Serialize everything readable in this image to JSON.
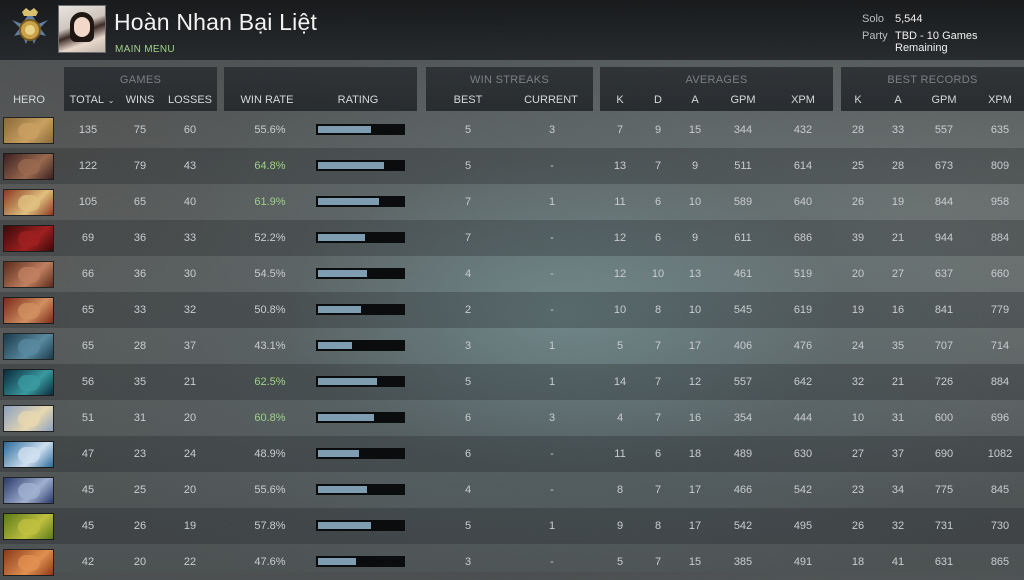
{
  "profile": {
    "name": "Hoàn Nhan Bại Liệt",
    "main_menu": "MAIN MENU",
    "solo_label": "Solo",
    "solo_value": "5,544",
    "party_label": "Party",
    "party_value": "TBD - 10 Games Remaining"
  },
  "groups": {
    "games": "GAMES",
    "win_streaks": "WIN STREAKS",
    "averages": "AVERAGES",
    "best_records": "BEST RECORDS"
  },
  "columns": {
    "hero": "HERO",
    "total": "TOTAL",
    "wins": "WINS",
    "losses": "LOSSES",
    "win_rate": "WIN RATE",
    "rating": "RATING",
    "best": "BEST",
    "current": "CURRENT",
    "k": "K",
    "d": "D",
    "a": "A",
    "gpm": "GPM",
    "xpm": "XPM",
    "best_k": "K",
    "best_a": "A",
    "best_gpm": "GPM",
    "best_xpm": "XPM"
  },
  "rows": [
    {
      "total": "135",
      "wins": "75",
      "losses": "60",
      "win_rate": "55.6%",
      "rating": 0.62,
      "best": "5",
      "current": "3",
      "k": "7",
      "d": "9",
      "a": "15",
      "gpm": "344",
      "xpm": "432",
      "bk": "28",
      "ba": "33",
      "bgpm": "557",
      "bxpm": "635",
      "colors": [
        "#8a6a3a",
        "#c9a060"
      ]
    },
    {
      "total": "122",
      "wins": "79",
      "losses": "43",
      "win_rate": "64.8%",
      "rating": 0.78,
      "best": "5",
      "current": "-",
      "k": "13",
      "d": "7",
      "a": "9",
      "gpm": "511",
      "xpm": "614",
      "bk": "25",
      "ba": "28",
      "bgpm": "673",
      "bxpm": "809",
      "colors": [
        "#3a2020",
        "#9a6a50"
      ]
    },
    {
      "total": "105",
      "wins": "65",
      "losses": "40",
      "win_rate": "61.9%",
      "rating": 0.72,
      "best": "7",
      "current": "1",
      "k": "11",
      "d": "6",
      "a": "10",
      "gpm": "589",
      "xpm": "640",
      "bk": "26",
      "ba": "19",
      "bgpm": "844",
      "bxpm": "958",
      "colors": [
        "#8a3a20",
        "#e0c080"
      ]
    },
    {
      "total": "69",
      "wins": "36",
      "losses": "33",
      "win_rate": "52.2%",
      "rating": 0.55,
      "best": "7",
      "current": "-",
      "k": "12",
      "d": "6",
      "a": "9",
      "gpm": "611",
      "xpm": "686",
      "bk": "39",
      "ba": "21",
      "bgpm": "944",
      "bxpm": "884",
      "colors": [
        "#3a0a0a",
        "#a02020"
      ]
    },
    {
      "total": "66",
      "wins": "36",
      "losses": "30",
      "win_rate": "54.5%",
      "rating": 0.58,
      "best": "4",
      "current": "-",
      "k": "12",
      "d": "10",
      "a": "13",
      "gpm": "461",
      "xpm": "519",
      "bk": "20",
      "ba": "27",
      "bgpm": "637",
      "bxpm": "660",
      "colors": [
        "#5a2a1a",
        "#c08060"
      ]
    },
    {
      "total": "65",
      "wins": "33",
      "losses": "32",
      "win_rate": "50.8%",
      "rating": 0.5,
      "best": "2",
      "current": "-",
      "k": "10",
      "d": "8",
      "a": "10",
      "gpm": "545",
      "xpm": "619",
      "bk": "19",
      "ba": "16",
      "bgpm": "841",
      "bxpm": "779",
      "colors": [
        "#7a2a1a",
        "#d09060"
      ]
    },
    {
      "total": "65",
      "wins": "28",
      "losses": "37",
      "win_rate": "43.1%",
      "rating": 0.4,
      "best": "3",
      "current": "1",
      "k": "5",
      "d": "7",
      "a": "17",
      "gpm": "406",
      "xpm": "476",
      "bk": "24",
      "ba": "35",
      "bgpm": "707",
      "bxpm": "714",
      "colors": [
        "#1a3a4a",
        "#5a8aa0"
      ]
    },
    {
      "total": "56",
      "wins": "35",
      "losses": "21",
      "win_rate": "62.5%",
      "rating": 0.7,
      "best": "5",
      "current": "1",
      "k": "14",
      "d": "7",
      "a": "12",
      "gpm": "557",
      "xpm": "642",
      "bk": "32",
      "ba": "21",
      "bgpm": "726",
      "bxpm": "884",
      "colors": [
        "#0a2a3a",
        "#3a9aa0"
      ]
    },
    {
      "total": "51",
      "wins": "31",
      "losses": "20",
      "win_rate": "60.8%",
      "rating": 0.66,
      "best": "6",
      "current": "3",
      "k": "4",
      "d": "7",
      "a": "16",
      "gpm": "354",
      "xpm": "444",
      "bk": "10",
      "ba": "31",
      "bgpm": "600",
      "bxpm": "696",
      "colors": [
        "#8aa0c0",
        "#e8d8b0"
      ]
    },
    {
      "total": "47",
      "wins": "23",
      "losses": "24",
      "win_rate": "48.9%",
      "rating": 0.48,
      "best": "6",
      "current": "-",
      "k": "11",
      "d": "6",
      "a": "18",
      "gpm": "489",
      "xpm": "630",
      "bk": "27",
      "ba": "37",
      "bgpm": "690",
      "bxpm": "1082",
      "colors": [
        "#2a6a9a",
        "#d0e0f0"
      ]
    },
    {
      "total": "45",
      "wins": "25",
      "losses": "20",
      "win_rate": "55.6%",
      "rating": 0.58,
      "best": "4",
      "current": "-",
      "k": "8",
      "d": "7",
      "a": "17",
      "gpm": "466",
      "xpm": "542",
      "bk": "23",
      "ba": "34",
      "bgpm": "775",
      "bxpm": "845",
      "colors": [
        "#2a3a6a",
        "#a0b0d0"
      ]
    },
    {
      "total": "45",
      "wins": "26",
      "losses": "19",
      "win_rate": "57.8%",
      "rating": 0.62,
      "best": "5",
      "current": "1",
      "k": "9",
      "d": "8",
      "a": "17",
      "gpm": "542",
      "xpm": "495",
      "bk": "26",
      "ba": "32",
      "bgpm": "731",
      "bxpm": "730",
      "colors": [
        "#5a7a1a",
        "#c0c040"
      ]
    },
    {
      "total": "42",
      "wins": "20",
      "losses": "22",
      "win_rate": "47.6%",
      "rating": 0.45,
      "best": "3",
      "current": "-",
      "k": "5",
      "d": "7",
      "a": "15",
      "gpm": "385",
      "xpm": "491",
      "bk": "18",
      "ba": "41",
      "bgpm": "631",
      "bxpm": "865",
      "colors": [
        "#8a3a1a",
        "#e09050"
      ]
    }
  ],
  "colors": {
    "accent_green": "#9fd18a",
    "rating_fill": "#7f9db0"
  }
}
